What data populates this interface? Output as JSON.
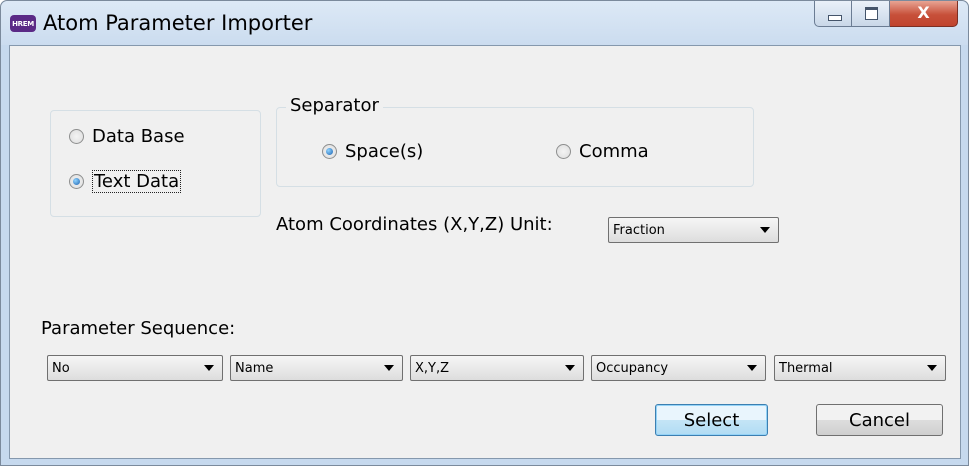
{
  "window": {
    "icon_text": "HREM",
    "title": "Atom Parameter Importer",
    "close_glyph": "X"
  },
  "source": {
    "options": [
      "Data Base",
      "Text Data"
    ],
    "selected": "Text Data"
  },
  "separator": {
    "caption": "Separator",
    "options": [
      "Space(s)",
      "Comma"
    ],
    "selected": "Space(s)"
  },
  "coordinates": {
    "label": "Atom Coordinates (X,Y,Z) Unit:",
    "value": "Fraction"
  },
  "sequence": {
    "label": "Parameter Sequence:",
    "columns": [
      "No",
      "Name",
      "X,Y,Z",
      "Occupancy",
      "Thermal"
    ]
  },
  "buttons": {
    "select": "Select",
    "cancel": "Cancel"
  },
  "colors": {
    "accent": "#1e63b0",
    "default_button": "#c4e5f6",
    "close_button": "#c7503a"
  }
}
